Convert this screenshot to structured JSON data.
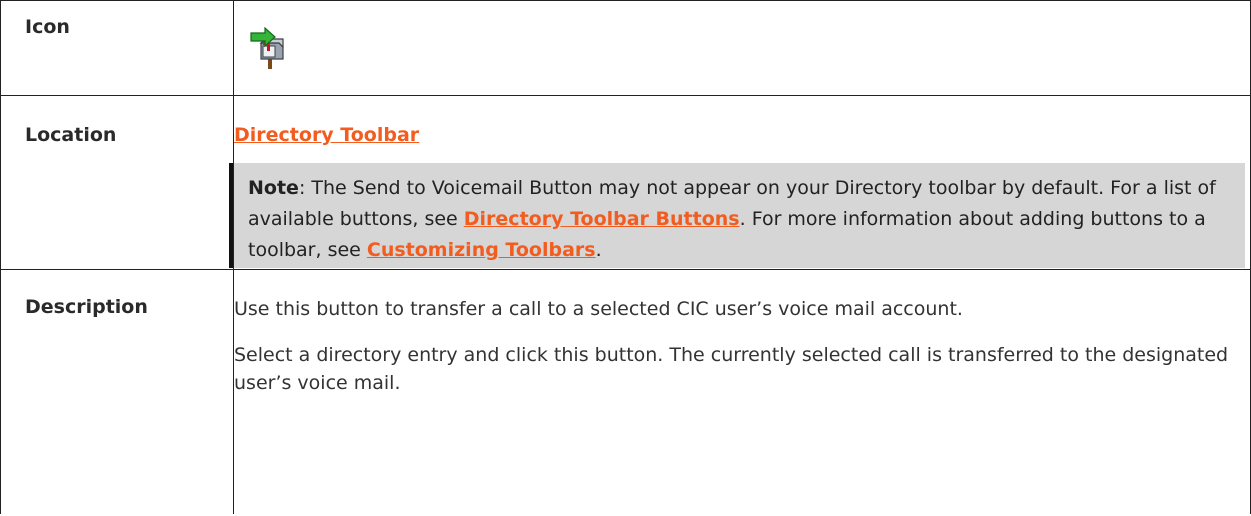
{
  "rows": {
    "icon": {
      "label": "Icon",
      "icon_name": "send-to-voicemail-icon"
    },
    "location": {
      "label": "Location",
      "link": "Directory Toolbar",
      "note": {
        "heading": "Note",
        "text1": ": The Send to Voicemail Button may not appear on your Directory toolbar by default. For a list of available buttons, see ",
        "link1": "Directory Toolbar Buttons",
        "text2": ". For more information about adding buttons to a toolbar, see ",
        "link2": "Customizing Toolbars",
        "text3": "."
      }
    },
    "description": {
      "label": "Description",
      "para1": "Use this button to transfer a call to a selected CIC user’s voice mail account.",
      "para2": "Select a directory entry and click this button. The currently selected call is transferred to the designated user’s voice mail."
    }
  },
  "colors": {
    "link": "#f25c1f",
    "note_bg": "#d6d6d6",
    "note_bar": "#111111"
  }
}
